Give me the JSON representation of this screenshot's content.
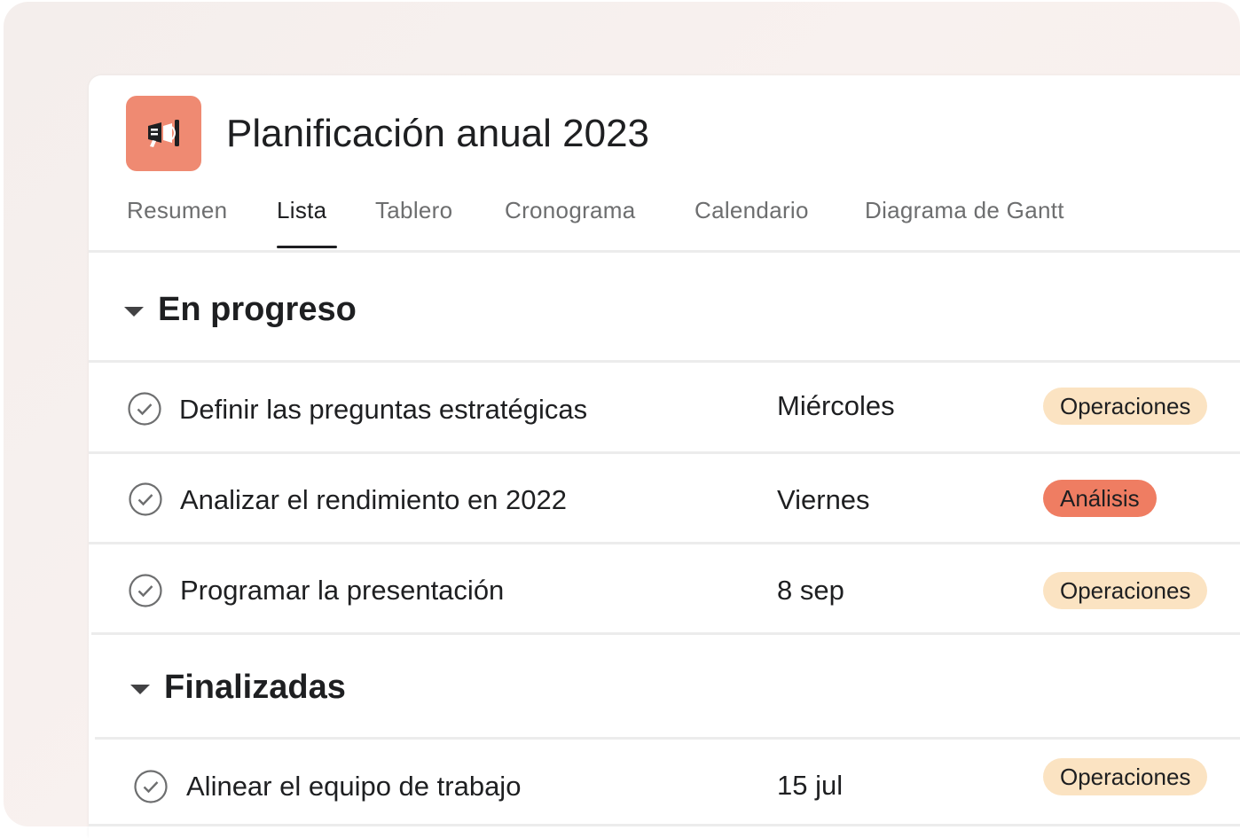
{
  "project": {
    "title": "Planificación anual 2023",
    "icon": "megaphone-icon",
    "icon_color": "#ef8a72"
  },
  "tabs": [
    {
      "label": "Resumen",
      "active": false
    },
    {
      "label": "Lista",
      "active": true
    },
    {
      "label": "Tablero",
      "active": false
    },
    {
      "label": "Cronograma",
      "active": false
    },
    {
      "label": "Calendario",
      "active": false
    },
    {
      "label": "Diagrama de Gantt",
      "active": false
    }
  ],
  "sections": [
    {
      "title": "En progreso",
      "tasks": [
        {
          "name": "Definir las preguntas estratégicas",
          "date": "Miércoles",
          "tag": "Operaciones"
        },
        {
          "name": "Analizar el rendimiento en 2022",
          "date": "Viernes",
          "tag": "Análisis"
        },
        {
          "name": "Programar la presentación",
          "date": "8 sep",
          "tag": "Operaciones"
        }
      ]
    },
    {
      "title": "Finalizadas",
      "tasks": [
        {
          "name": "Alinear el equipo de trabajo",
          "date": "15 jul",
          "tag": "Operaciones"
        }
      ]
    }
  ],
  "tag_colors": {
    "Operaciones": {
      "bg": "#fbe3c2",
      "fg": "#1e1f21"
    },
    "Análisis": {
      "bg": "#ef7d62",
      "fg": "#1e1f21"
    }
  }
}
